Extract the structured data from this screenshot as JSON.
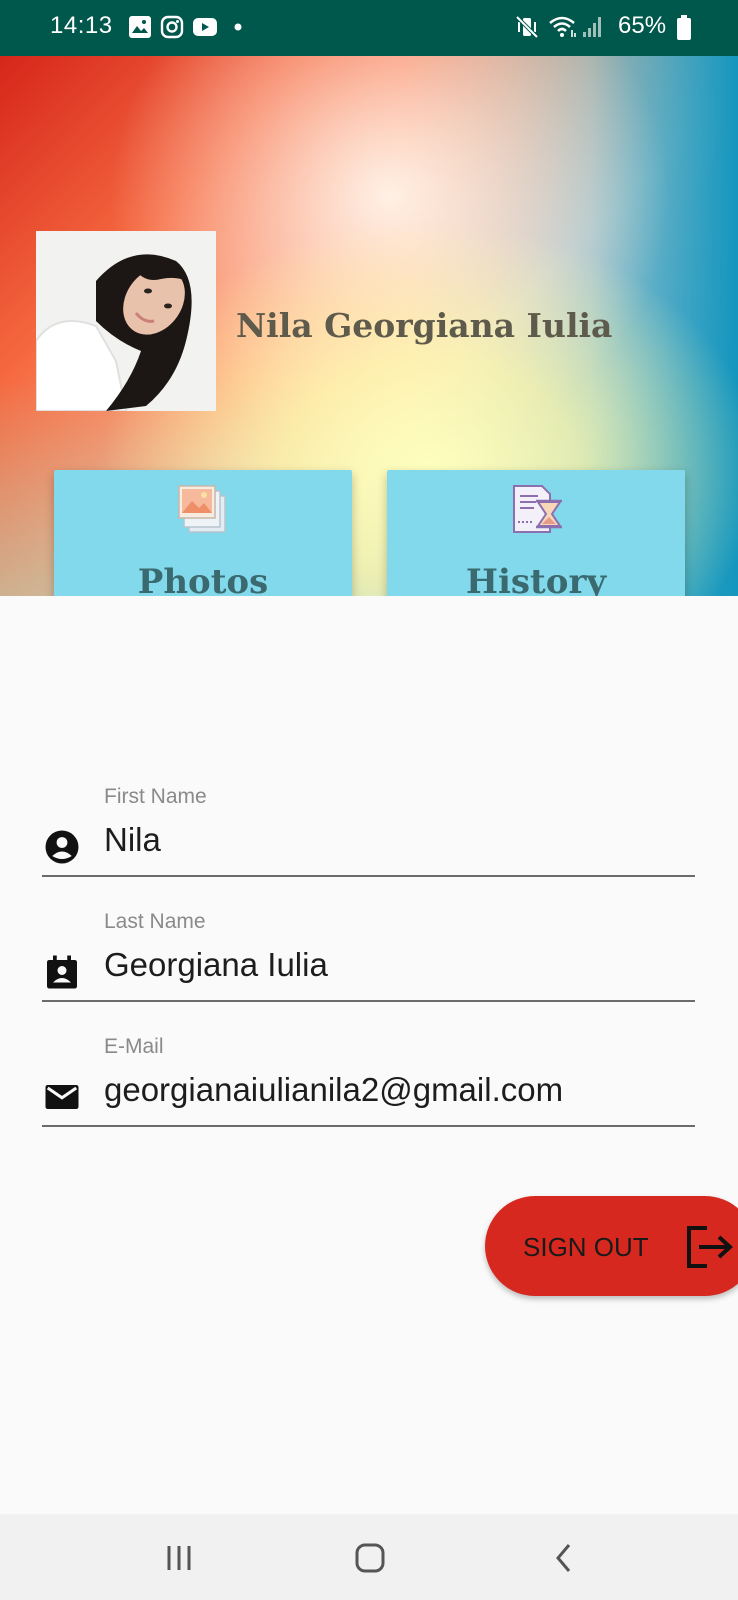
{
  "status_bar": {
    "time": "14:13",
    "battery_percent": "65%",
    "icons": [
      "image-icon",
      "instagram-icon",
      "youtube-icon",
      "dot-icon",
      "mute-vibrate-icon",
      "wifi-icon",
      "signal-icon",
      "battery-icon"
    ]
  },
  "profile": {
    "name": "Nila Georgiana Iulia"
  },
  "cards": {
    "photos_label": "Photos",
    "history_label": "History"
  },
  "form": {
    "first_name_label": "First Name",
    "first_name_value": "Nila",
    "last_name_label": "Last Name",
    "last_name_value": "Georgiana Iulia",
    "email_label": "E-Mail",
    "email_value": "georgianaiulianila2@gmail.com"
  },
  "actions": {
    "sign_out_label": "SIGN OUT"
  },
  "colors": {
    "status_bar": "#00574b",
    "card_bg": "#83d9ec",
    "sign_out_bg": "#d6281f",
    "card_text": "#3a6a70"
  }
}
